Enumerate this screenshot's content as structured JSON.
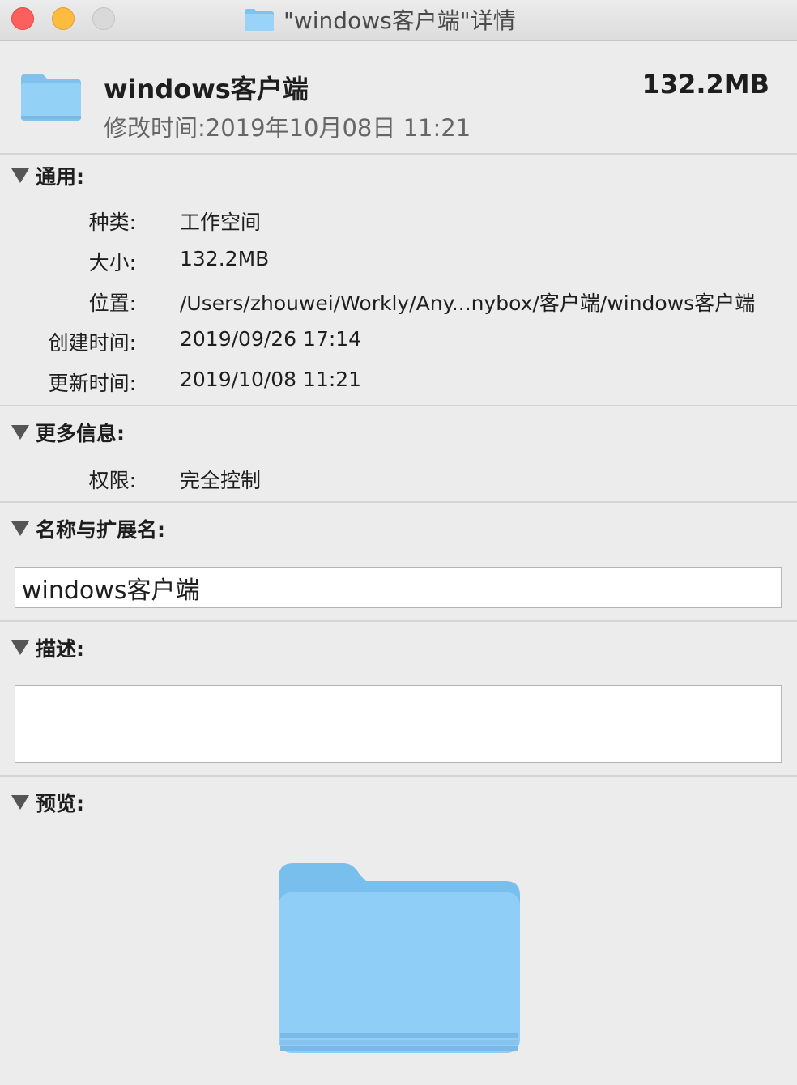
{
  "window": {
    "title": "\"windows客户端\"详情"
  },
  "summary": {
    "name": "windows客户端",
    "modified": "修改时间:2019年10月08日  11:21",
    "size": "132.2MB",
    "icon": "folder-icon"
  },
  "general": {
    "title": "通用:",
    "rows": [
      {
        "label": "种类:",
        "value": "工作空间"
      },
      {
        "label": "大小:",
        "value": "132.2MB"
      },
      {
        "label": "位置:",
        "value": "/Users/zhouwei/Workly/Any...nybox/客户端/windows客户端"
      },
      {
        "label": "创建时间:",
        "value": "2019/09/26  17:14"
      },
      {
        "label": "更新时间:",
        "value": "2019/10/08  11:21"
      }
    ]
  },
  "more_info": {
    "title": "更多信息:",
    "rows": [
      {
        "label": "权限:",
        "value": "完全控制"
      }
    ]
  },
  "name_ext": {
    "title": "名称与扩展名:",
    "value": "windows客户端"
  },
  "description": {
    "title": "描述:",
    "value": ""
  },
  "preview": {
    "title": "预览:",
    "icon": "folder-icon"
  },
  "colors": {
    "close": "#fc605c",
    "minimize": "#fdbc40",
    "zoom": "#d9d9d9",
    "folder": "#8ccdf6"
  }
}
